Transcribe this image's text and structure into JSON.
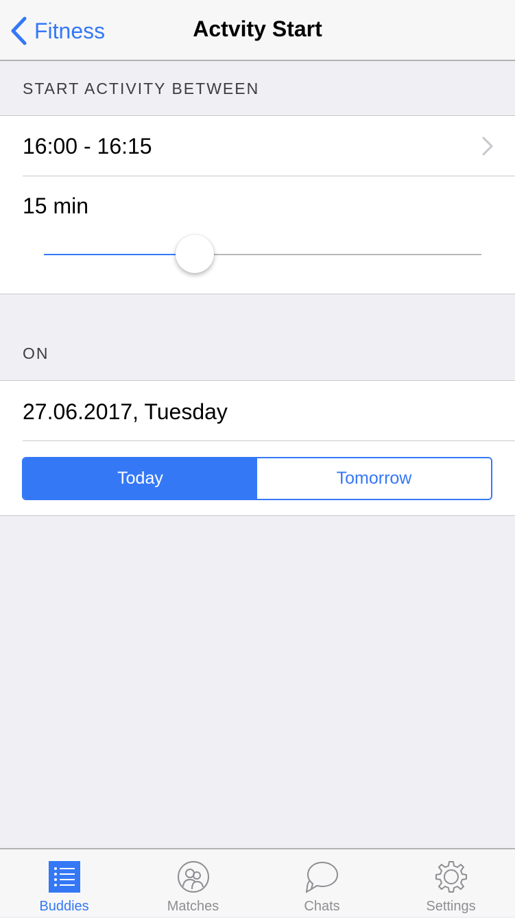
{
  "navbar": {
    "back_label": "Fitness",
    "title": "Actvity Start"
  },
  "section_time": {
    "header": "START ACTIVITY BETWEEN",
    "time_range": "16:00 - 16:15",
    "duration_label": "15 min",
    "slider_value_fraction": 0.33
  },
  "section_date": {
    "header": "ON",
    "date_label": "27.06.2017, Tuesday",
    "segments": [
      "Today",
      "Tomorrow"
    ],
    "selected_segment": "Today"
  },
  "tabbar": {
    "tabs": [
      {
        "label": "Buddies",
        "icon": "list-icon",
        "active": true
      },
      {
        "label": "Matches",
        "icon": "people-icon",
        "active": false
      },
      {
        "label": "Chats",
        "icon": "chat-bubbles-icon",
        "active": false
      },
      {
        "label": "Settings",
        "icon": "gear-icon",
        "active": false
      }
    ]
  },
  "colors": {
    "accent": "#3478f6",
    "background": "#efeff4",
    "inactive_tab": "#8e8e93"
  }
}
